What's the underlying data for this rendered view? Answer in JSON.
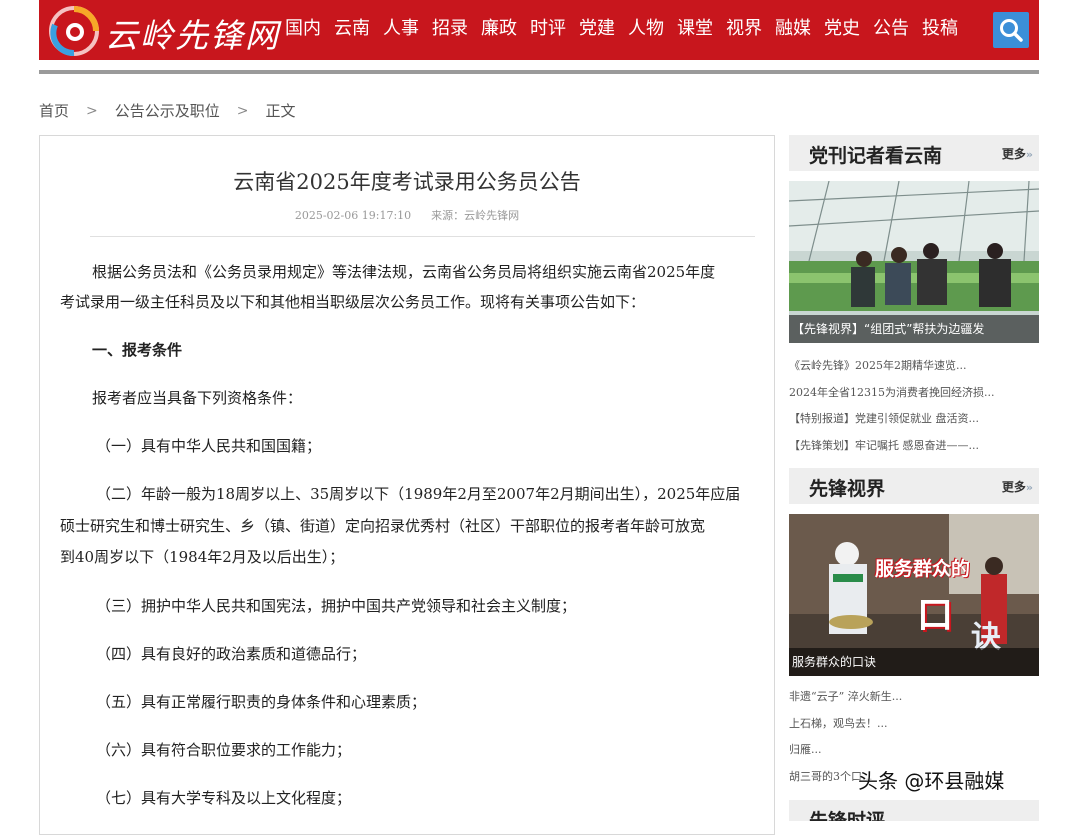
{
  "site": {
    "logo_text": "云岭先锋网"
  },
  "nav": [
    "国内",
    "云南",
    "人事",
    "招录",
    "廉政",
    "时评",
    "党建",
    "人物",
    "课堂",
    "视界",
    "融媒",
    "党史",
    "公告",
    "投稿"
  ],
  "breadcrumb": {
    "home": "首页",
    "category": "公告公示及职位",
    "current": "正文",
    "sep": ">"
  },
  "article": {
    "title": "云南省2025年度考试录用公务员公告",
    "date": "2025-02-06 19:17:10",
    "source": "来源：云岭先锋网",
    "paragraphs": [
      "根据公务员法和《公务员录用规定》等法律法规，云南省公务员局将组织实施云南省2025年度",
      "考试录用一级主任科员及以下和其他相当职级层次公务员工作。现将有关事项公告如下：",
      "一、报考条件",
      "报考者应当具备下列资格条件：",
      "（一）具有中华人民共和国国籍；",
      "（二）年龄一般为18周岁以上、35周岁以下（1989年2月至2007年2月期间出生），2025年应届",
      "硕士研究生和博士研究生、乡（镇、街道）定向招录优秀村（社区）干部职位的报考者年龄可放宽",
      "到40周岁以下（1984年2月及以后出生）；",
      "（三）拥护中华人民共和国宪法，拥护中国共产党领导和社会主义制度；",
      "（四）具有良好的政治素质和道德品行；",
      "（五）具有正常履行职责的身体条件和心理素质；",
      "（六）具有符合职位要求的工作能力；",
      "（七）具有大学专科及以上文化程度；"
    ]
  },
  "sidebar": {
    "more_label": "更多",
    "section1": {
      "title": "党刊记者看云南",
      "image_caption": "【先锋视界】“组团式”帮扶为边疆发",
      "links": [
        "《云岭先锋》2025年2期精华速览...",
        "2024年全省12315为消费者挽回经济损...",
        "【特别报道】党建引领促就业 盘活资...",
        "【先锋策划】牢记嘱托 感恩奋进——..."
      ]
    },
    "section2": {
      "title": "先锋视界",
      "image_caption": "服务群众的口诀",
      "image_overlay": "服务群众的",
      "image_overlay_big": "口",
      "image_overlay_big2": "诀",
      "links": [
        "非遗“云子” 淬火新生...",
        "上石梯，观鸟去！...",
        "归雁...",
        "胡三哥的3个口..."
      ]
    },
    "section3": {
      "title": "先锋时评"
    }
  },
  "watermark": "头条 @环县融媒"
}
